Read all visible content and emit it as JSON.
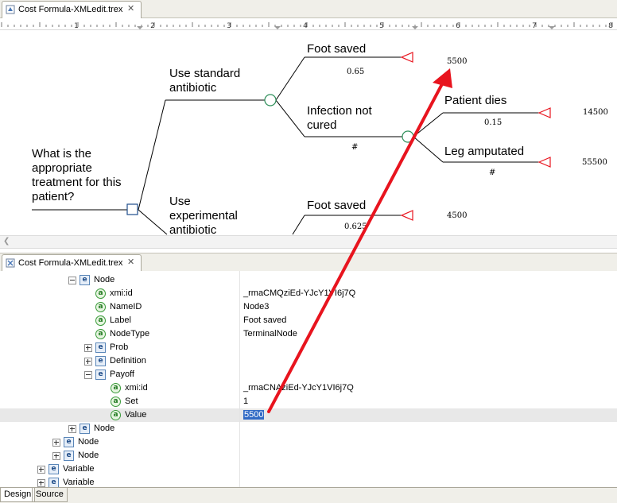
{
  "editor_tab": {
    "title": "Cost Formula-XMLedit.trex"
  },
  "ruler": {
    "numbers": [
      "1",
      "2",
      "3",
      "4",
      "5",
      "6",
      "7",
      "8"
    ]
  },
  "diagram": {
    "root_question": [
      "What is the",
      "appropriate",
      "treatment for this",
      "patient?"
    ],
    "branch_standard": [
      "Use standard",
      "antibiotic"
    ],
    "branch_experimental": [
      "Use",
      "experimental",
      "antibiotic"
    ],
    "foot_saved_1": {
      "label": "Foot saved",
      "prob": "0.65",
      "payoff": "5500"
    },
    "infection": {
      "label": [
        "Infection not",
        "cured"
      ],
      "prob": "#"
    },
    "patient_dies": {
      "label": "Patient dies",
      "prob": "0.15",
      "payoff": "14500"
    },
    "leg_amputated": {
      "label": "Leg amputated",
      "prob": "#",
      "payoff": "55500"
    },
    "foot_saved_2": {
      "label": "Foot saved",
      "prob": "0.625",
      "payoff": "4500"
    }
  },
  "tree_tab": {
    "title": "Cost Formula-XMLedit.trex"
  },
  "tree": {
    "rows": [
      {
        "label": "Node",
        "value": "",
        "kind": "e",
        "expander": "minus"
      },
      {
        "label": "xmi:id",
        "value": "_rmaCMQziEd-YJcY1VI6j7Q",
        "kind": "a",
        "expander": ""
      },
      {
        "label": "NameID",
        "value": "Node3",
        "kind": "a",
        "expander": ""
      },
      {
        "label": "Label",
        "value": "Foot saved",
        "kind": "a",
        "expander": ""
      },
      {
        "label": "NodeType",
        "value": "TerminalNode",
        "kind": "a",
        "expander": ""
      },
      {
        "label": "Prob",
        "value": "",
        "kind": "e",
        "expander": "plus"
      },
      {
        "label": "Definition",
        "value": "",
        "kind": "e",
        "expander": "plus"
      },
      {
        "label": "Payoff",
        "value": "",
        "kind": "e",
        "expander": "minus"
      },
      {
        "label": "xmi:id",
        "value": "_rmaCNAziEd-YJcY1VI6j7Q",
        "kind": "a",
        "expander": ""
      },
      {
        "label": "Set",
        "value": "1",
        "kind": "a",
        "expander": ""
      },
      {
        "label": "Value",
        "value": "5500",
        "kind": "a",
        "expander": ""
      },
      {
        "label": "Node",
        "value": "",
        "kind": "e",
        "expander": "plus"
      },
      {
        "label": "Node",
        "value": "",
        "kind": "e",
        "expander": "plus"
      },
      {
        "label": "Node",
        "value": "",
        "kind": "e",
        "expander": "plus"
      },
      {
        "label": "Variable",
        "value": "",
        "kind": "e",
        "expander": "plus"
      },
      {
        "label": "Variable",
        "value": "",
        "kind": "e",
        "expander": "plus"
      }
    ]
  },
  "bottom_tabs": {
    "design": "Design",
    "source": "Source"
  },
  "colors": {
    "arrow": "#e8141e",
    "terminal": "#e8141e",
    "chance": "#2f8f5a",
    "decision": "#1e4e8c",
    "selection": "#316ac5"
  },
  "icons": {
    "tab_icon": "xml-file-icon",
    "close": "close-icon",
    "element": "element-icon",
    "attribute": "attribute-icon"
  }
}
